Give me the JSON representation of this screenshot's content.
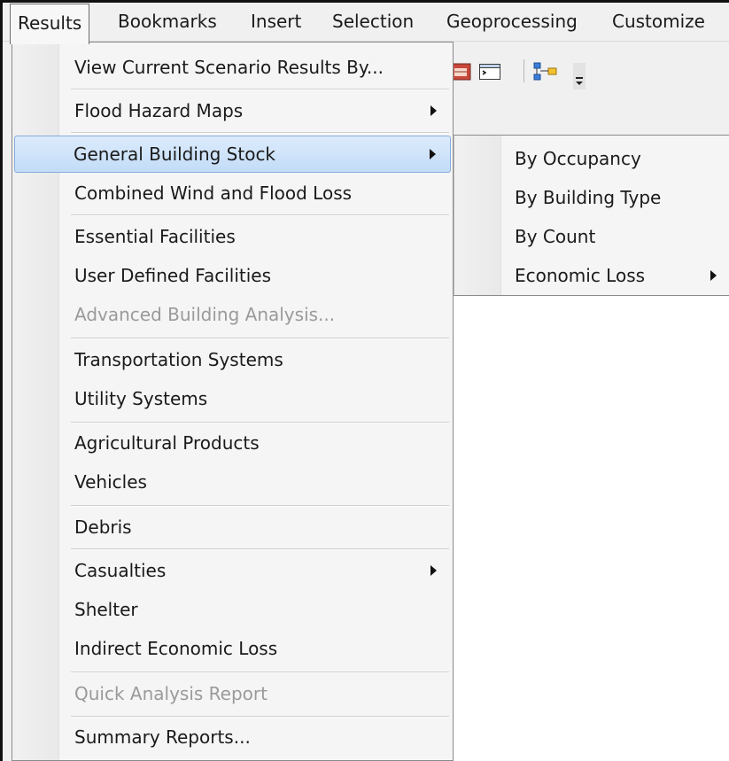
{
  "menubar": {
    "items": [
      {
        "label": "Results"
      },
      {
        "label": "Bookmarks"
      },
      {
        "label": "Insert"
      },
      {
        "label": "Selection"
      },
      {
        "label": "Geoprocessing"
      },
      {
        "label": "Customize"
      }
    ]
  },
  "toolbar": {
    "icons": [
      "table-icon",
      "command-line-icon",
      "model-builder-icon",
      "toolbar-overflow-icon"
    ]
  },
  "menu": {
    "items": [
      {
        "label": "View Current Scenario Results By...",
        "enabled": true,
        "submenu": false
      },
      {
        "label": "Flood Hazard Maps",
        "enabled": true,
        "submenu": true
      },
      {
        "label": "General Building Stock",
        "enabled": true,
        "submenu": true,
        "highlighted": true
      },
      {
        "label": "Combined Wind and Flood Loss",
        "enabled": true,
        "submenu": false
      },
      {
        "label": "Essential Facilities",
        "enabled": true,
        "submenu": false
      },
      {
        "label": "User Defined Facilities",
        "enabled": true,
        "submenu": false
      },
      {
        "label": "Advanced Building Analysis...",
        "enabled": false,
        "submenu": false
      },
      {
        "label": "Transportation Systems",
        "enabled": true,
        "submenu": false
      },
      {
        "label": "Utility Systems",
        "enabled": true,
        "submenu": false
      },
      {
        "label": "Agricultural Products",
        "enabled": true,
        "submenu": false
      },
      {
        "label": "Vehicles",
        "enabled": true,
        "submenu": false
      },
      {
        "label": "Debris",
        "enabled": true,
        "submenu": false
      },
      {
        "label": "Casualties",
        "enabled": true,
        "submenu": true
      },
      {
        "label": "Shelter",
        "enabled": true,
        "submenu": false
      },
      {
        "label": "Indirect Economic Loss",
        "enabled": true,
        "submenu": false
      },
      {
        "label": "Quick Analysis Report",
        "enabled": false,
        "submenu": false
      },
      {
        "label": "Summary Reports...",
        "enabled": true,
        "submenu": false
      }
    ]
  },
  "submenu": {
    "items": [
      {
        "label": "By Occupancy",
        "submenu": false
      },
      {
        "label": "By Building Type",
        "submenu": false
      },
      {
        "label": "By Count",
        "submenu": false
      },
      {
        "label": "Economic Loss",
        "submenu": true
      }
    ]
  },
  "colors": {
    "highlight_top": "#dcebfc",
    "highlight_bottom": "#c3dcf8",
    "highlight_border": "#84acdd",
    "disabled_text": "#9a9a9a",
    "menu_bg": "#f5f5f5"
  }
}
